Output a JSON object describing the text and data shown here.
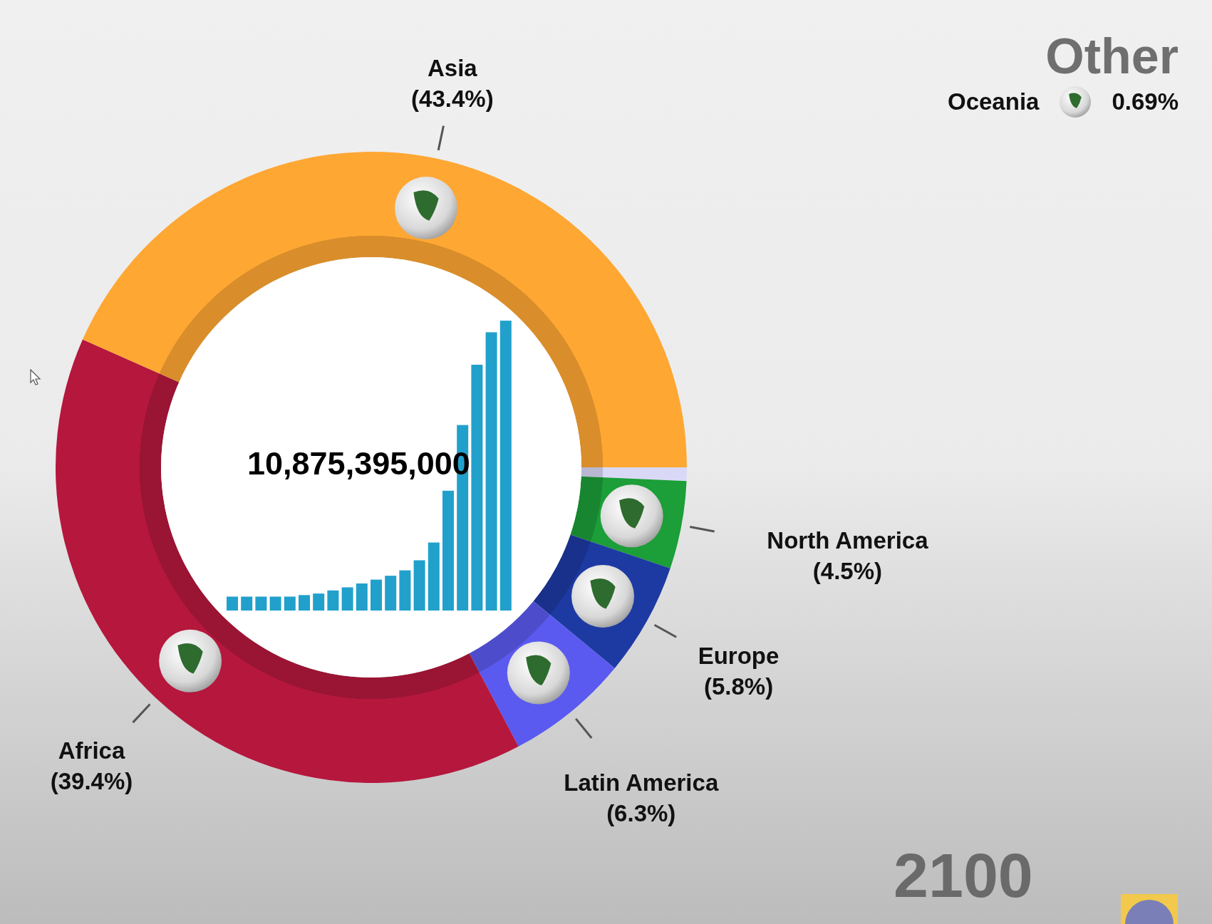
{
  "chart": {
    "chart_data": {
      "type": "donut",
      "categories": [
        "Oceania",
        "North America",
        "Europe",
        "Latin America",
        "Africa",
        "Asia"
      ],
      "values": [
        0.69,
        4.5,
        5.8,
        6.3,
        39.4,
        43.4
      ],
      "value_labels": [
        "0.69%",
        "(4.5%)",
        "(5.8%)",
        "(6.3%)",
        "(39.4%)",
        "(43.4%)"
      ]
    },
    "slices": [
      {
        "kind": "other",
        "color": "#d9d9f7"
      },
      {
        "kind": "labeled",
        "color": "#1c9e38"
      },
      {
        "kind": "labeled",
        "color": "#1d3aa3"
      },
      {
        "kind": "labeled",
        "color": "#5a5af0"
      },
      {
        "kind": "labeled",
        "color": "#b5173d"
      },
      {
        "kind": "labeled",
        "color": "#ffa733"
      }
    ],
    "total": "10,875,395,000"
  },
  "other": {
    "title": "Other"
  },
  "year": "2100"
}
